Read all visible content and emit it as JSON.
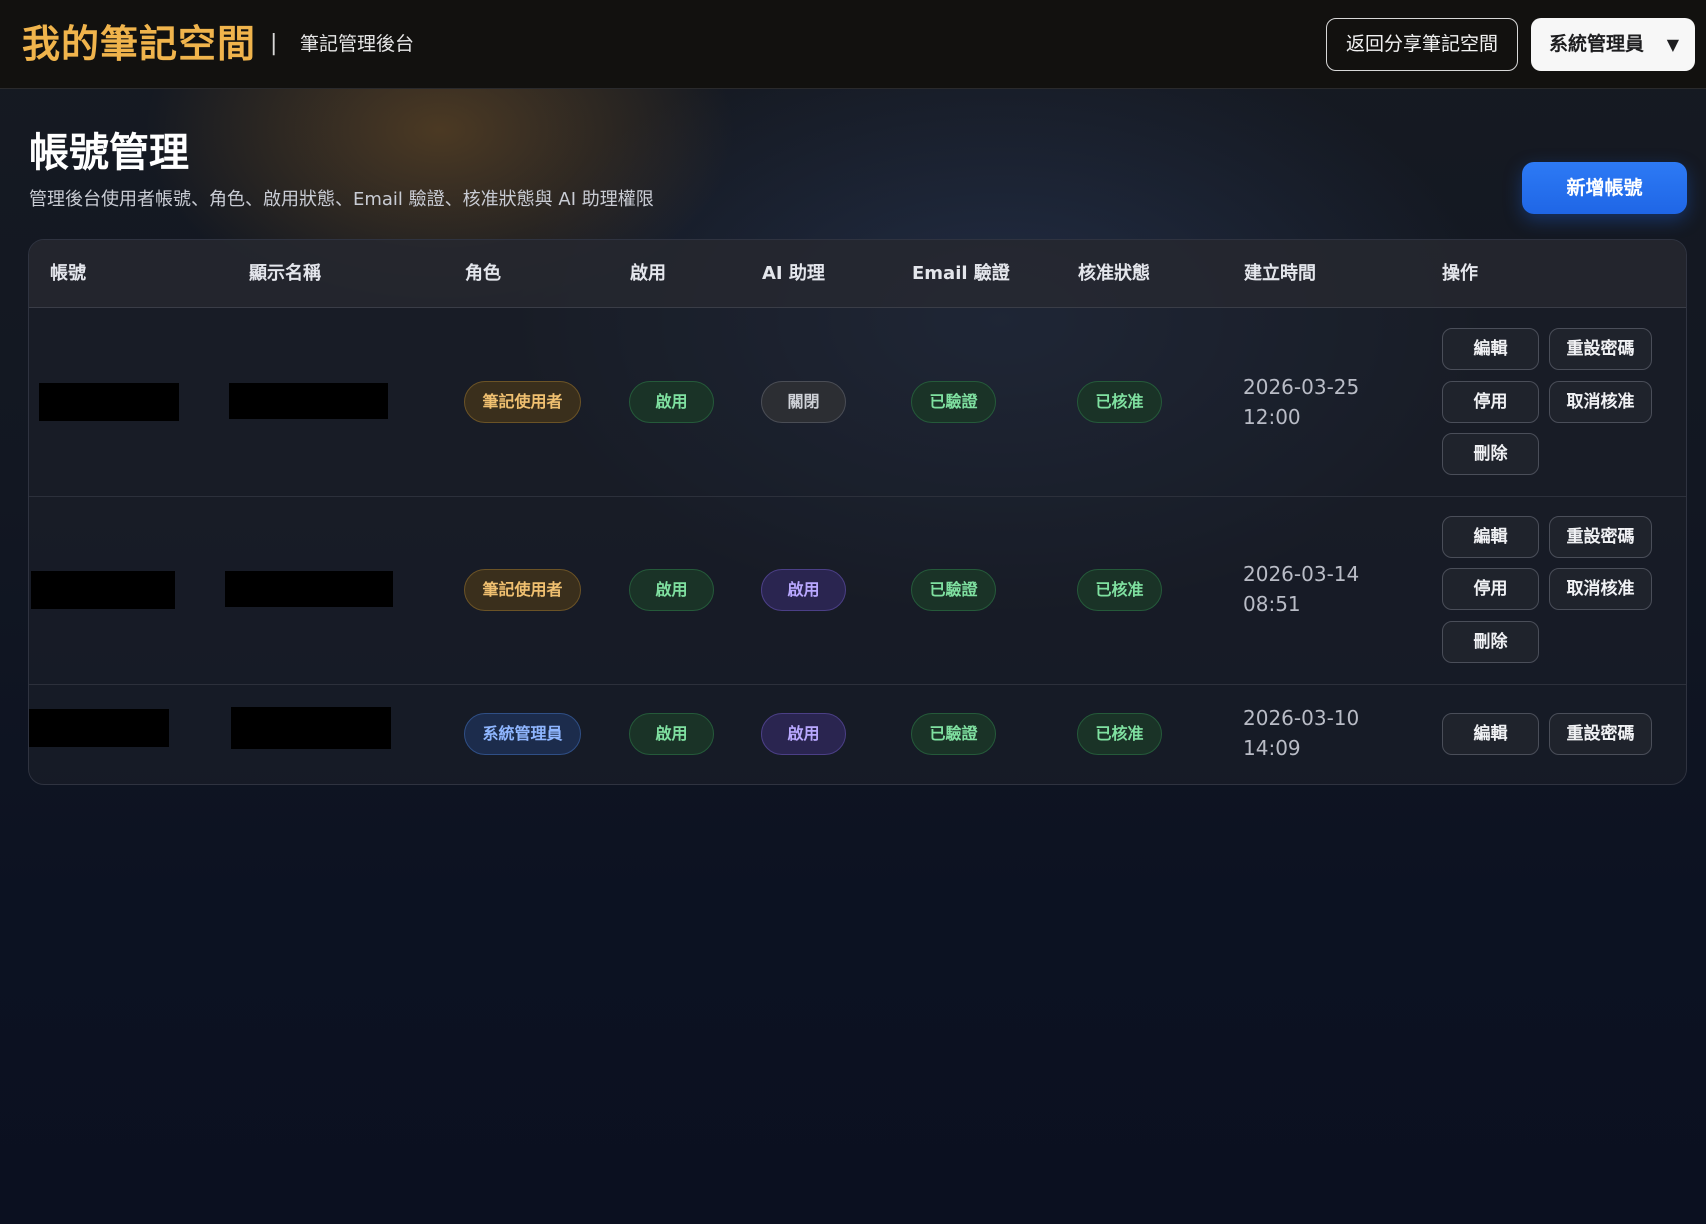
{
  "header": {
    "brand": "我的筆記空間",
    "separator": "|",
    "subtitle": "筆記管理後台",
    "back_button": "返回分享筆記空間",
    "user_menu": "系統管理員",
    "user_menu_caret": "▼"
  },
  "page": {
    "title": "帳號管理",
    "description": "管理後台使用者帳號、角色、啟用狀態、Email 驗證、核准狀態與 AI 助理權限",
    "add_button": "新增帳號"
  },
  "table": {
    "columns": [
      "帳號",
      "顯示名稱",
      "角色",
      "啟用",
      "AI 助理",
      "Email 驗證",
      "核准狀態",
      "建立時間",
      "操作"
    ],
    "rows": [
      {
        "role": "筆記使用者",
        "enabled": "啟用",
        "ai": "關閉",
        "email": "已驗證",
        "approval": "已核准",
        "created_date": "2026-03-25",
        "created_time": "12:00",
        "actions": [
          "編輯",
          "重設密碼",
          "停用",
          "取消核准",
          "刪除"
        ]
      },
      {
        "role": "筆記使用者",
        "enabled": "啟用",
        "ai": "啟用",
        "email": "已驗證",
        "approval": "已核准",
        "created_date": "2026-03-14",
        "created_time": "08:51",
        "actions": [
          "編輯",
          "重設密碼",
          "停用",
          "取消核准",
          "刪除"
        ]
      },
      {
        "role": "系統管理員",
        "enabled": "啟用",
        "ai": "啟用",
        "email": "已驗證",
        "approval": "已核准",
        "created_date": "2026-03-10",
        "created_time": "14:09",
        "actions": [
          "編輯",
          "重設密碼"
        ]
      }
    ]
  },
  "colors": {
    "brand": "#f0b44c",
    "primary_button": "#1f66e6",
    "badge_green": "#7fe0a0",
    "badge_purple": "#b9a8ff",
    "badge_blue": "#8fb6ff",
    "badge_gold": "#f0c070"
  }
}
